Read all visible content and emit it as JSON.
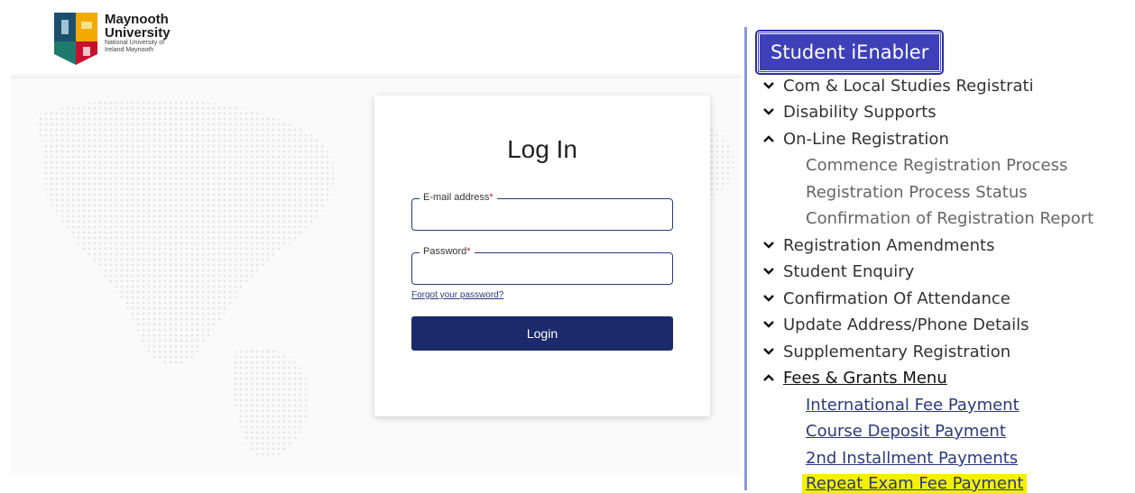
{
  "portal": {
    "brand_name": "Maynooth University",
    "brand_sub": "National University of Ireland Maynooth",
    "login_title": "Log In",
    "email_label": "E-mail address",
    "password_label": "Password",
    "required_mark": "*",
    "forgot_link": "Forgot your password?",
    "login_button": "Login"
  },
  "menu": {
    "title": "Student iEnabler",
    "items": [
      {
        "label": "Com & Local Studies Registrati",
        "icon": "chevron-down-icon"
      },
      {
        "label": "Disability Supports",
        "icon": "chevron-down-icon"
      },
      {
        "label": "On-Line Registration",
        "icon": "chevron-up-icon"
      },
      {
        "label": "Registration Amendments",
        "icon": "chevron-down-icon"
      },
      {
        "label": "Student Enquiry",
        "icon": "chevron-down-icon"
      },
      {
        "label": "Confirmation Of Attendance",
        "icon": "chevron-down-icon"
      },
      {
        "label": "Update Address/Phone Details",
        "icon": "chevron-down-icon"
      },
      {
        "label": "Supplementary Registration",
        "icon": "chevron-down-icon"
      },
      {
        "label": "Fees & Grants Menu",
        "icon": "chevron-up-icon"
      }
    ],
    "online_registration_sub": [
      "Commence Registration Process",
      "Registration Process Status",
      "Confirmation of Registration Report"
    ],
    "fees_sub": [
      "International Fee Payment",
      "Course Deposit Payment",
      "2nd Installment Payments",
      "Repeat Exam Fee Payment"
    ]
  },
  "colors": {
    "navy": "#1b2a6b",
    "menu_title_bg": "#3d40b8",
    "highlight": "#f4f000"
  }
}
